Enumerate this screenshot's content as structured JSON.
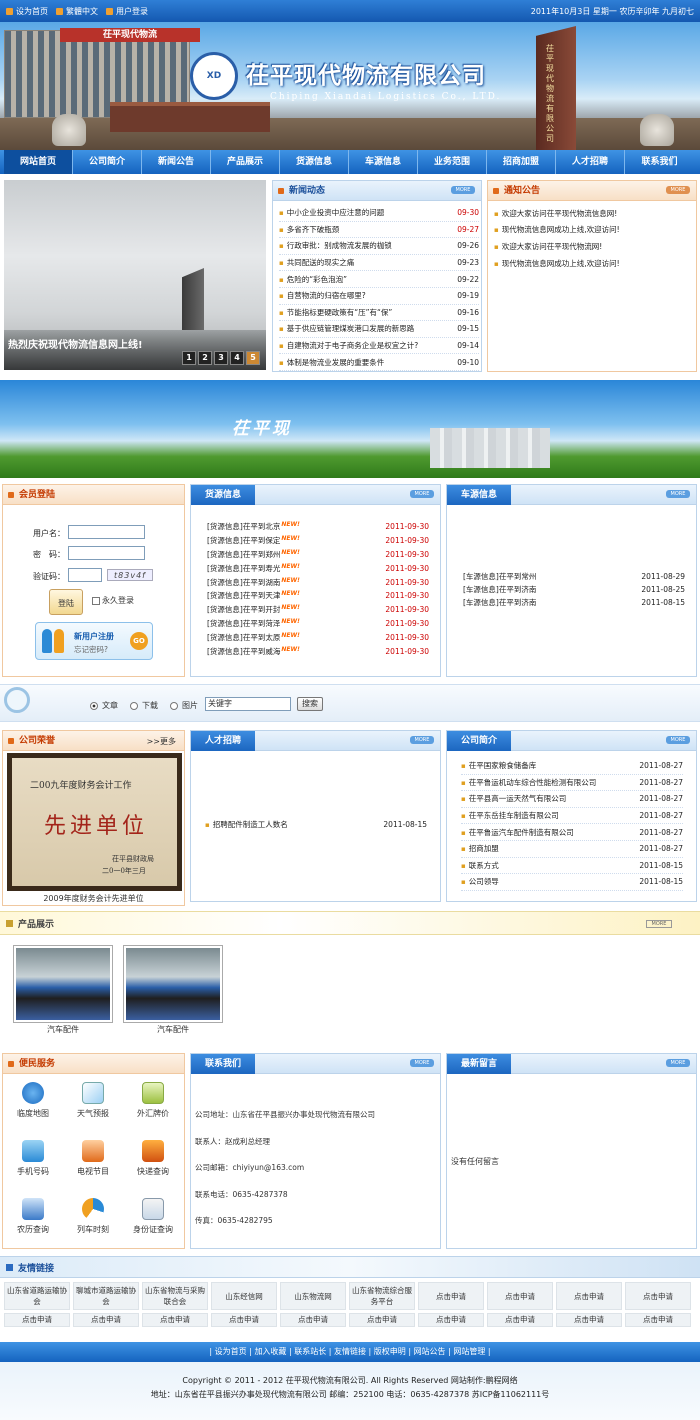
{
  "topbar": {
    "links": [
      "设为首页",
      "繁體中文",
      "用户登录"
    ],
    "date": "2011年10月3日 星期一 农历辛卯年 九月初七"
  },
  "header": {
    "logo_text": "XD",
    "company_name": "茌平现代物流有限公司",
    "company_en": "Chiping Xiandai Logistics Co., LTD.",
    "gate_sign": "茌平现代物流",
    "tower_sign": "茌平现代物流有限公司"
  },
  "nav": [
    "网站首页",
    "公司简介",
    "新闻公告",
    "产品展示",
    "货源信息",
    "车源信息",
    "业务范围",
    "招商加盟",
    "人才招聘",
    "联系我们"
  ],
  "slide": {
    "caption": "热烈庆祝现代物流信息网上线!",
    "pages": [
      "1",
      "2",
      "3",
      "4",
      "5"
    ]
  },
  "news": {
    "title": "新闻动态",
    "more": "MORE",
    "items": [
      {
        "t": "中小企业投资中应注意的问题",
        "d": "09-30",
        "hot": true
      },
      {
        "t": "多省齐下破瓶颈",
        "d": "09-27",
        "hot": true
      },
      {
        "t": "行政审批：别成物流发展的枷锁",
        "d": "09-26",
        "hot": false
      },
      {
        "t": "共同配送的现实之痛",
        "d": "09-23",
        "hot": false
      },
      {
        "t": "危险的“彩色泡泡”",
        "d": "09-22",
        "hot": false
      },
      {
        "t": "自营物流的归宿在哪里?",
        "d": "09-19",
        "hot": false
      },
      {
        "t": "节能指标更硬政策有“压”有“保”",
        "d": "09-16",
        "hot": false
      },
      {
        "t": "基于供应链管理煤炭港口发展的新思路",
        "d": "09-15",
        "hot": false
      },
      {
        "t": "自建物流对于电子商务企业是权宜之计?",
        "d": "09-14",
        "hot": false
      },
      {
        "t": "体制是物流业发展的重要条件",
        "d": "09-10",
        "hot": false
      }
    ]
  },
  "notice": {
    "title": "通知公告",
    "more": "MORE",
    "items": [
      "欢迎大家访问茌平现代物流信息网!",
      "现代物流信息网成功上线,欢迎访问!",
      "欢迎大家访问茌平现代物流网!",
      "现代物流信息网成功上线,欢迎访问!"
    ]
  },
  "band_text": "茌平现",
  "login": {
    "title": "会员登陆",
    "username_label": "用户名：",
    "password_label": "密　码：",
    "captcha_label": "验证码：",
    "captcha_img": "t83v4f",
    "login_btn": "登陆",
    "remember": "永久登录",
    "register": "新用户注册",
    "forgot": "忘记密码?",
    "go": "GO"
  },
  "cargo": {
    "title": "货源信息",
    "more": "MORE",
    "new_tag": "NEW!",
    "items": [
      {
        "t": "[货源信息]茌平到北京",
        "d": "2011-09-30"
      },
      {
        "t": "[货源信息]茌平到保定",
        "d": "2011-09-30"
      },
      {
        "t": "[货源信息]茌平到郑州",
        "d": "2011-09-30"
      },
      {
        "t": "[货源信息]茌平到寿光",
        "d": "2011-09-30"
      },
      {
        "t": "[货源信息]茌平到湖南",
        "d": "2011-09-30"
      },
      {
        "t": "[货源信息]茌平到天津",
        "d": "2011-09-30"
      },
      {
        "t": "[货源信息]茌平到开封",
        "d": "2011-09-30"
      },
      {
        "t": "[货源信息]茌平到菏泽",
        "d": "2011-09-30"
      },
      {
        "t": "[货源信息]茌平到太原",
        "d": "2011-09-30"
      },
      {
        "t": "[货源信息]茌平到威海",
        "d": "2011-09-30"
      }
    ]
  },
  "vehicle": {
    "title": "车源信息",
    "more": "MORE",
    "items": [
      {
        "t": "[车源信息]茌平到常州",
        "d": "2011-08-29"
      },
      {
        "t": "[车源信息]茌平到济南",
        "d": "2011-08-25"
      },
      {
        "t": "[车源信息]茌平到济南",
        "d": "2011-08-15"
      }
    ]
  },
  "search": {
    "options": [
      "文章",
      "下载",
      "图片"
    ],
    "keyword": "关键字",
    "button": "搜索"
  },
  "honor": {
    "title": "公司荣誉",
    "more": ">>更多",
    "plaque_top": "二00九年度财务会计工作",
    "plaque_main": "先进单位",
    "plaque_sign": "茌平县财政局",
    "plaque_date": "二0一0年三月",
    "caption": "2009年度财务会计先进单位"
  },
  "jobs": {
    "title": "人才招聘",
    "more": "MORE",
    "items": [
      {
        "t": "招聘配件制造工人数名",
        "d": "2011-08-15"
      }
    ]
  },
  "about": {
    "title": "公司简介",
    "more": "MORE",
    "items": [
      {
        "t": "茌平国家粮食储备库",
        "d": "2011-08-27"
      },
      {
        "t": "茌平鲁运机动车综合性能检测有限公司",
        "d": "2011-08-27"
      },
      {
        "t": "茌平县高一运天然气有限公司",
        "d": "2011-08-27"
      },
      {
        "t": "茌平东岳挂车制造有限公司",
        "d": "2011-08-27"
      },
      {
        "t": "茌平鲁运汽车配件制造有限公司",
        "d": "2011-08-27"
      },
      {
        "t": "招商加盟",
        "d": "2011-08-27"
      },
      {
        "t": "联系方式",
        "d": "2011-08-15"
      },
      {
        "t": "公司领导",
        "d": "2011-08-15"
      }
    ]
  },
  "products": {
    "title": "产品展示",
    "more": "MORE",
    "items": [
      "汽车配件",
      "汽车配件"
    ]
  },
  "services": {
    "title": "便民服务",
    "items": [
      "IP地址查询",
      "天气预报",
      "外汇牌价",
      "手机号码",
      "电视节目",
      "快递查询",
      "农历查询",
      "列车时刻",
      "身份证查询"
    ],
    "first_label": "临度地图"
  },
  "contact": {
    "title": "联系我们",
    "more": "MORE",
    "lines": [
      "公司地址：山东省茌平县振兴办事处现代物流有限公司",
      "联系人：赵成利总经理",
      "公司邮箱：chiyiyun@163.com",
      "联系电话：0635-4287378",
      "传真：0635-4282795"
    ]
  },
  "guestbook": {
    "title": "最新留言",
    "more": "MORE",
    "empty": "没有任何留言"
  },
  "links": {
    "title": "友情链接",
    "row1": [
      "山东省道路运输协会",
      "聊城市道路运输协会",
      "山东省物流与采购联合会",
      "山东经信网",
      "山东物流网",
      "山东省物流综合服务平台",
      "点击申请",
      "点击申请",
      "点击申请",
      "点击申请"
    ],
    "row2": [
      "点击申请",
      "点击申请",
      "点击申请",
      "点击申请",
      "点击申请",
      "点击申请",
      "点击申请",
      "点击申请",
      "点击申请",
      "点击申请"
    ]
  },
  "footer": {
    "nav": [
      "设为首页",
      "加入收藏",
      "联系站长",
      "友情链接",
      "版权申明",
      "网站公告",
      "网站管理"
    ],
    "copyright": "Copyright © 2011 - 2012 茌平现代物流有限公司. All Rights Reserved 网站制作:鹏程网络",
    "address": "地址：山东省茌平县振兴办事处现代物流有限公司 邮编：252100 电话：0635-4287378 苏ICP备11062111号"
  }
}
